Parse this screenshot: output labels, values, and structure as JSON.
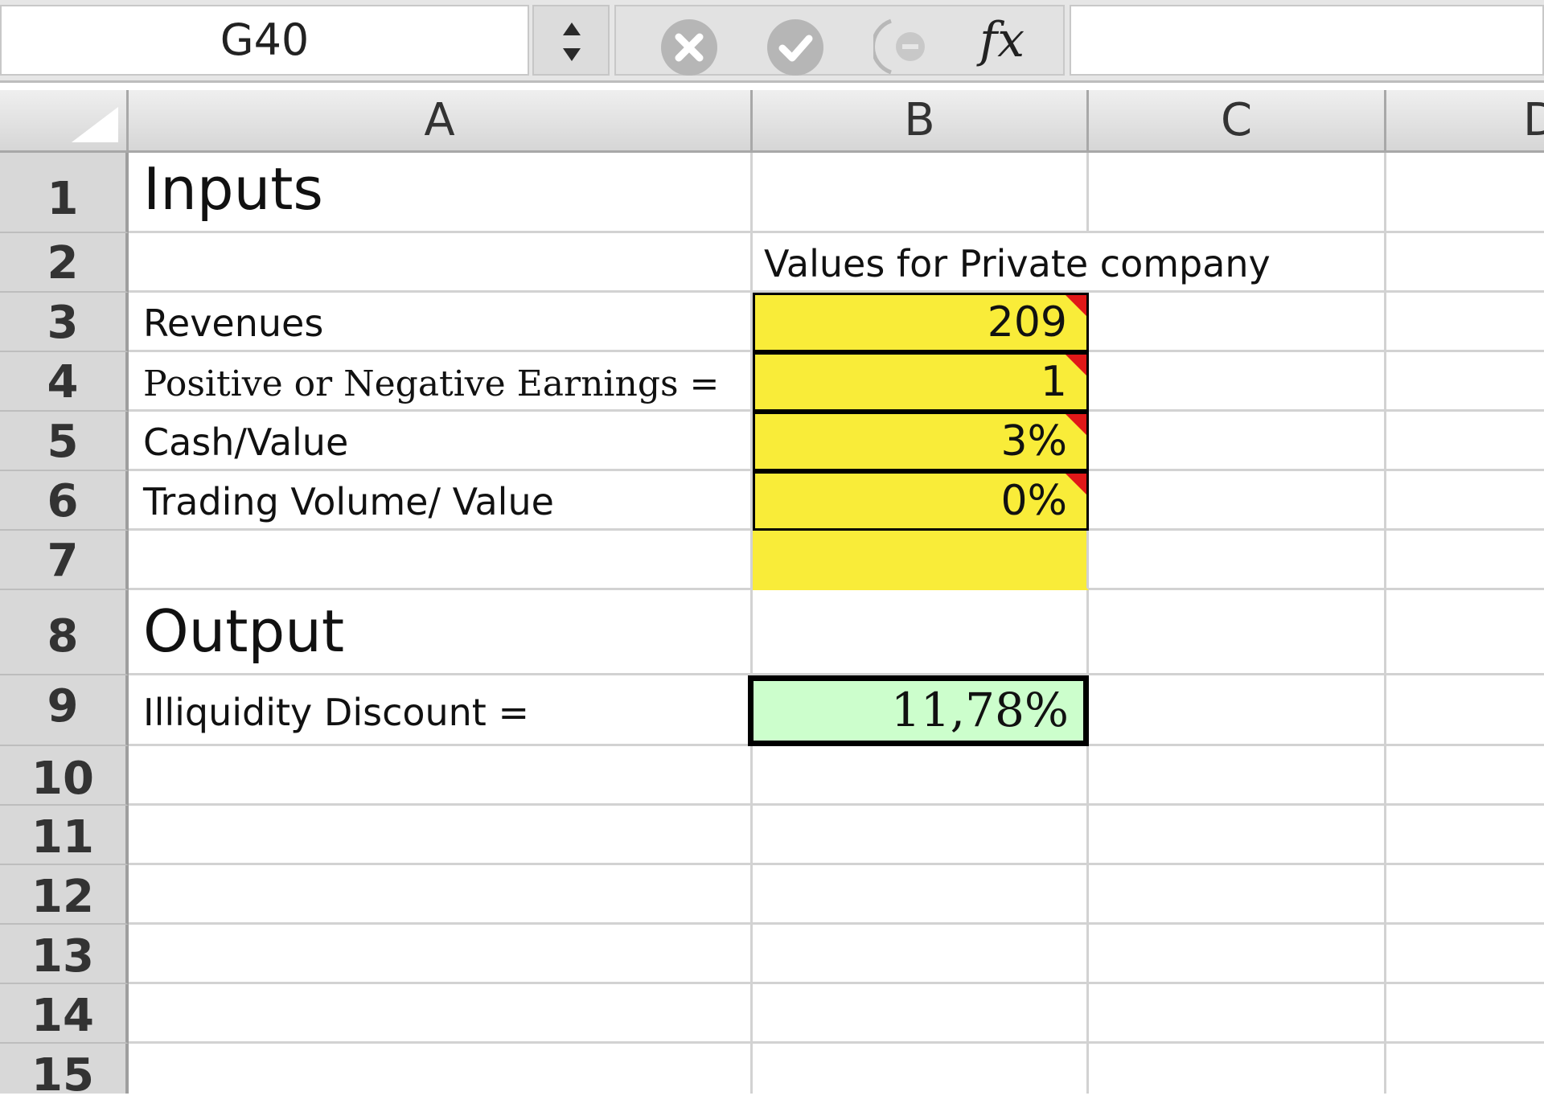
{
  "formula_bar": {
    "name_box": "G40",
    "fx_label": "fx",
    "formula": ""
  },
  "columns": [
    "A",
    "B",
    "C",
    "D"
  ],
  "rows": [
    "1",
    "2",
    "3",
    "4",
    "5",
    "6",
    "7",
    "8",
    "9",
    "10",
    "11",
    "12",
    "13",
    "14",
    "15"
  ],
  "sheet": {
    "inputs_heading": "Inputs",
    "values_header": "Values for Private company",
    "revenues_label": "Revenues",
    "revenues_value": "209",
    "earnings_label": "Positive or Negative Earnings =",
    "earnings_value": "1",
    "cash_label": "Cash/Value",
    "cash_value": "3%",
    "trading_label": "Trading Volume/ Value",
    "trading_value": "0%",
    "output_heading": "Output",
    "discount_label": "Illiquidity Discount =",
    "discount_value": "11,78%"
  },
  "colors": {
    "input_fill": "#f9ec39",
    "output_fill": "#ccfecc",
    "comment_marker": "#e01818"
  }
}
